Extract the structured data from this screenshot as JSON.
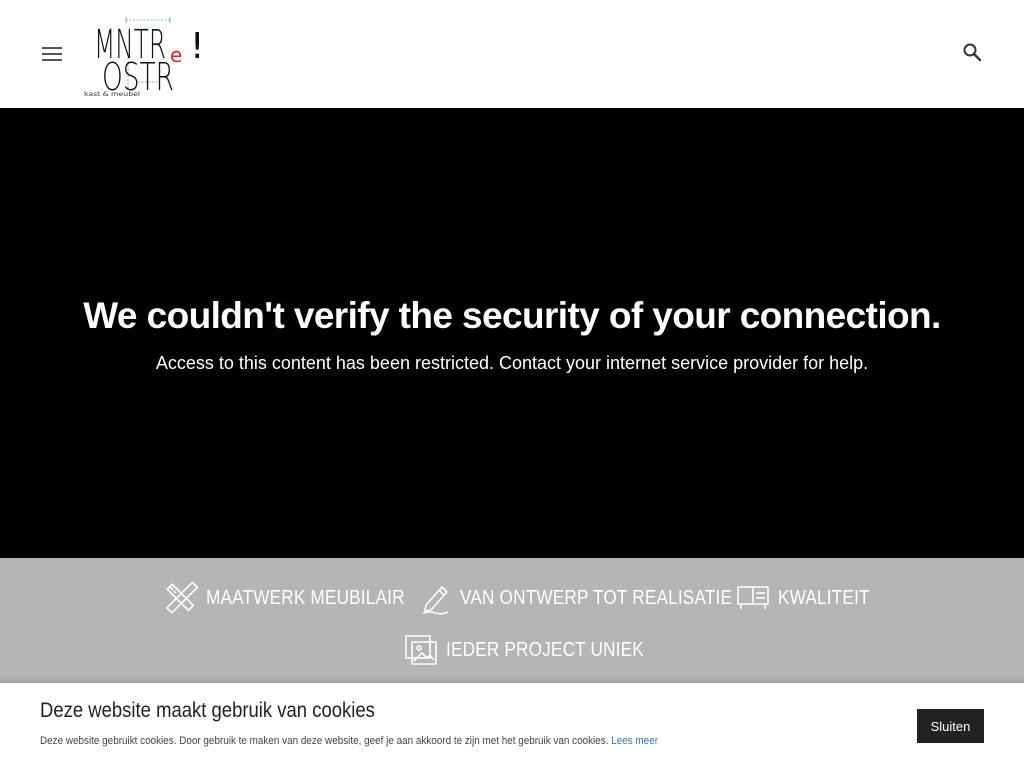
{
  "header": {
    "menu_icon": "hamburger-menu-icon",
    "search_icon": "search-icon",
    "logo": {
      "letters_top": "MNTR",
      "letters_bottom": "OSTR",
      "letter_e": "e",
      "exclamation": "!",
      "tagline": "kast & meubel",
      "accent_color": "#d9232e"
    }
  },
  "hero": {
    "title": "We couldn't verify the security of your connection.",
    "subtitle": "Access to this content has been restricted. Contact your internet service provider for help."
  },
  "features": [
    {
      "icon": "ruler-pencil-icon",
      "label": "Maatwerk meubilair"
    },
    {
      "icon": "pencil-icon",
      "label": "Van ontwerp tot realisatie"
    },
    {
      "icon": "cabinet-icon",
      "label": "Kwaliteit"
    },
    {
      "icon": "images-icon",
      "label": "Ieder project uniek"
    }
  ],
  "cookie": {
    "title": "Deze website maakt gebruik van cookies",
    "text": "Deze website gebruikt cookies. Door gebruik te maken van deze website, geef je aan akkoord te zijn met het gebruik van cookies.",
    "link_label": "Lees meer",
    "close_label": "Sluiten"
  },
  "colors": {
    "hero_background": "#000000",
    "features_background": "#b5b5b5",
    "link": "#3a77b8",
    "button": "#222222"
  }
}
